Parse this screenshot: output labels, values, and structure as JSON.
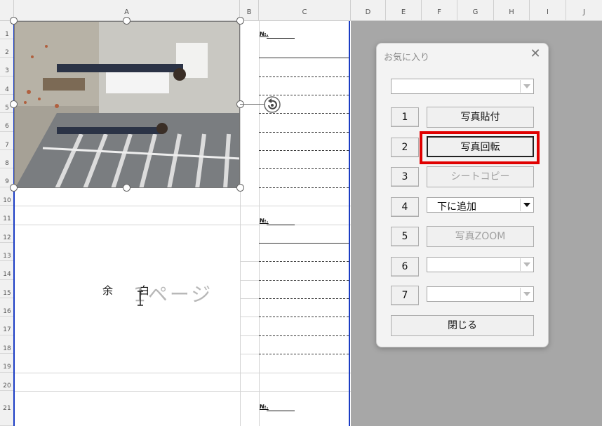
{
  "spreadsheet": {
    "columns": [
      "A",
      "B",
      "C",
      "D",
      "E",
      "F",
      "G",
      "H",
      "I",
      "J"
    ],
    "rows": [
      "1",
      "2",
      "3",
      "4",
      "5",
      "6",
      "7",
      "8",
      "9",
      "10",
      "11",
      "12",
      "13",
      "14",
      "15",
      "16",
      "17",
      "18",
      "19",
      "20",
      "21"
    ],
    "no_label": "№.",
    "margin_text_1": "余",
    "margin_text_2": "白",
    "page_watermark": "1ページ"
  },
  "dialog": {
    "title": "お気に入り",
    "close_icon": "close-icon",
    "top_combo_value": "",
    "rows": [
      {
        "number": "1",
        "action": "写真貼付",
        "kind": "button",
        "enabled": true
      },
      {
        "number": "2",
        "action": "写真回転",
        "kind": "button",
        "enabled": true,
        "selected": true
      },
      {
        "number": "3",
        "action": "シートコピー",
        "kind": "button",
        "enabled": false
      },
      {
        "number": "4",
        "action": "下に追加",
        "kind": "combo"
      },
      {
        "number": "5",
        "action": "写真ZOOM",
        "kind": "button",
        "enabled": false
      },
      {
        "number": "6",
        "action": "",
        "kind": "combo"
      },
      {
        "number": "7",
        "action": "",
        "kind": "combo"
      }
    ],
    "close_button": "閉じる"
  },
  "colors": {
    "highlight": "#e00000",
    "page_break": "#1a3cc4",
    "outside_area": "#a7a7a7"
  }
}
